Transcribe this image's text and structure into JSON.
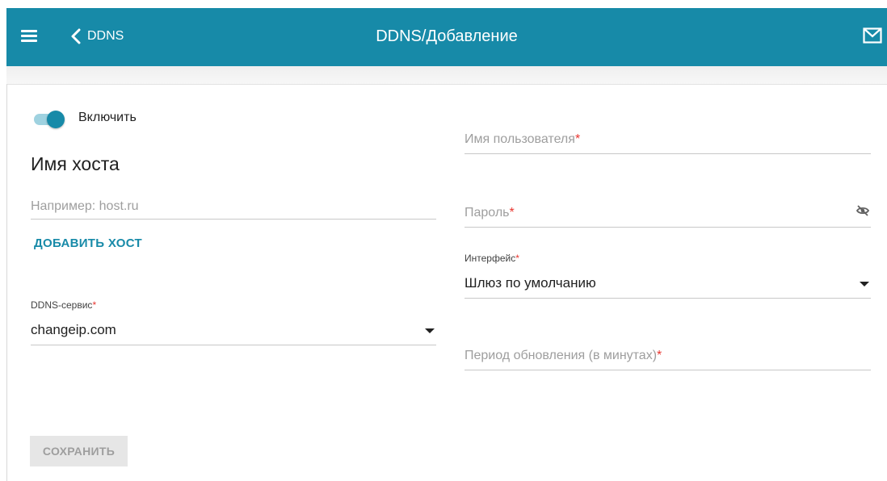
{
  "header": {
    "back_label": "DDNS",
    "title": "DDNS/Добавление",
    "accent_color": "#178aa8"
  },
  "form": {
    "enable_label": "Включить",
    "enable_on": true,
    "host_section_title": "Имя хоста",
    "host_placeholder": "Например: host.ru",
    "add_host_label": "ДОБАВИТЬ ХОСТ",
    "ddns_service": {
      "label": "DDNS-сервис",
      "value": "changeip.com"
    },
    "username": {
      "label": "Имя пользователя"
    },
    "password": {
      "label": "Пароль"
    },
    "interface": {
      "label": "Интерфейс",
      "value": "Шлюз по умолчанию"
    },
    "update_period": {
      "label": "Период обновления (в минутах)"
    },
    "required_mark": "*",
    "save_label": "СОХРАНИТЬ"
  },
  "icons": {
    "menu": "hamburger-icon",
    "back": "chevron-left-icon",
    "mail": "mail-icon",
    "password_visibility": "eye-off-icon",
    "dropdown": "caret-down-icon"
  }
}
